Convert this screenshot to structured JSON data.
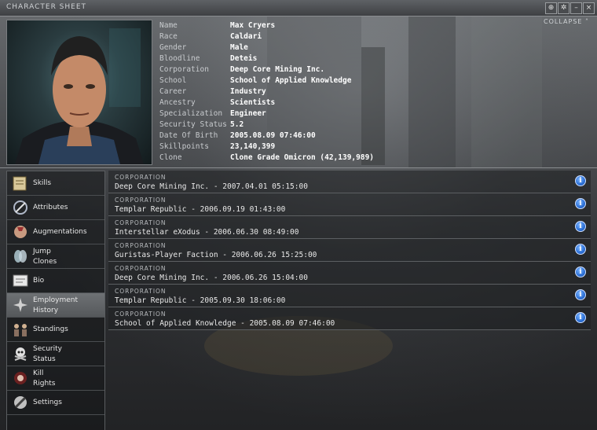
{
  "window": {
    "title": "CHARACTER SHEET",
    "collapse_label": "COLLAPSE",
    "buttons": [
      "⊕",
      "✲",
      "–",
      "×"
    ]
  },
  "character": {
    "fields": [
      {
        "label": "Name",
        "value": "Max Cryers"
      },
      {
        "label": "Race",
        "value": "Caldari"
      },
      {
        "label": "Gender",
        "value": "Male"
      },
      {
        "label": "Bloodline",
        "value": "Deteis"
      },
      {
        "label": "Corporation",
        "value": "Deep Core Mining Inc."
      },
      {
        "label": "School",
        "value": "School of Applied Knowledge"
      },
      {
        "label": "Career",
        "value": "Industry"
      },
      {
        "label": "Ancestry",
        "value": "Scientists"
      },
      {
        "label": "Specialization",
        "value": "Engineer"
      },
      {
        "label": "Security Status",
        "value": "5.2"
      },
      {
        "label": "Date Of Birth",
        "value": "2005.08.09 07:46:00"
      },
      {
        "label": "Skillpoints",
        "value": "23,140,399"
      },
      {
        "label": "Clone",
        "value": "Clone Grade Omicron (42,139,989)"
      }
    ]
  },
  "sidebar": {
    "items": [
      {
        "line1": "Skills",
        "line2": "",
        "icon": "skills-book-icon"
      },
      {
        "line1": "Attributes",
        "line2": "",
        "icon": "attributes-icon"
      },
      {
        "line1": "Augmentations",
        "line2": "",
        "icon": "augmentations-icon"
      },
      {
        "line1": "Jump",
        "line2": "Clones",
        "icon": "jump-clones-icon"
      },
      {
        "line1": "Bio",
        "line2": "",
        "icon": "bio-icon"
      },
      {
        "line1": "Employment",
        "line2": "History",
        "icon": "employment-history-icon",
        "active": true
      },
      {
        "line1": "Standings",
        "line2": "",
        "icon": "standings-icon"
      },
      {
        "line1": "Security",
        "line2": "Status",
        "icon": "security-status-icon"
      },
      {
        "line1": "Kill",
        "line2": "Rights",
        "icon": "kill-rights-icon"
      },
      {
        "line1": "Settings",
        "line2": "",
        "icon": "settings-icon"
      }
    ]
  },
  "employment": {
    "header": "CORPORATION",
    "rows": [
      {
        "text": "Deep Core Mining Inc. - 2007.04.01 05:15:00"
      },
      {
        "text": "Templar Republic - 2006.09.19 01:43:00"
      },
      {
        "text": "Interstellar eXodus - 2006.06.30 08:49:00"
      },
      {
        "text": "Guristas-Player Faction - 2006.06.26 15:25:00"
      },
      {
        "text": "Deep Core Mining Inc. - 2006.06.26 15:04:00"
      },
      {
        "text": "Templar Republic - 2005.09.30 18:06:00"
      },
      {
        "text": "School of Applied Knowledge - 2005.08.09 07:46:00"
      }
    ],
    "info_glyph": "i"
  },
  "colors": {
    "info_button": "#2b6fd6",
    "active_item": "#6e7174"
  }
}
